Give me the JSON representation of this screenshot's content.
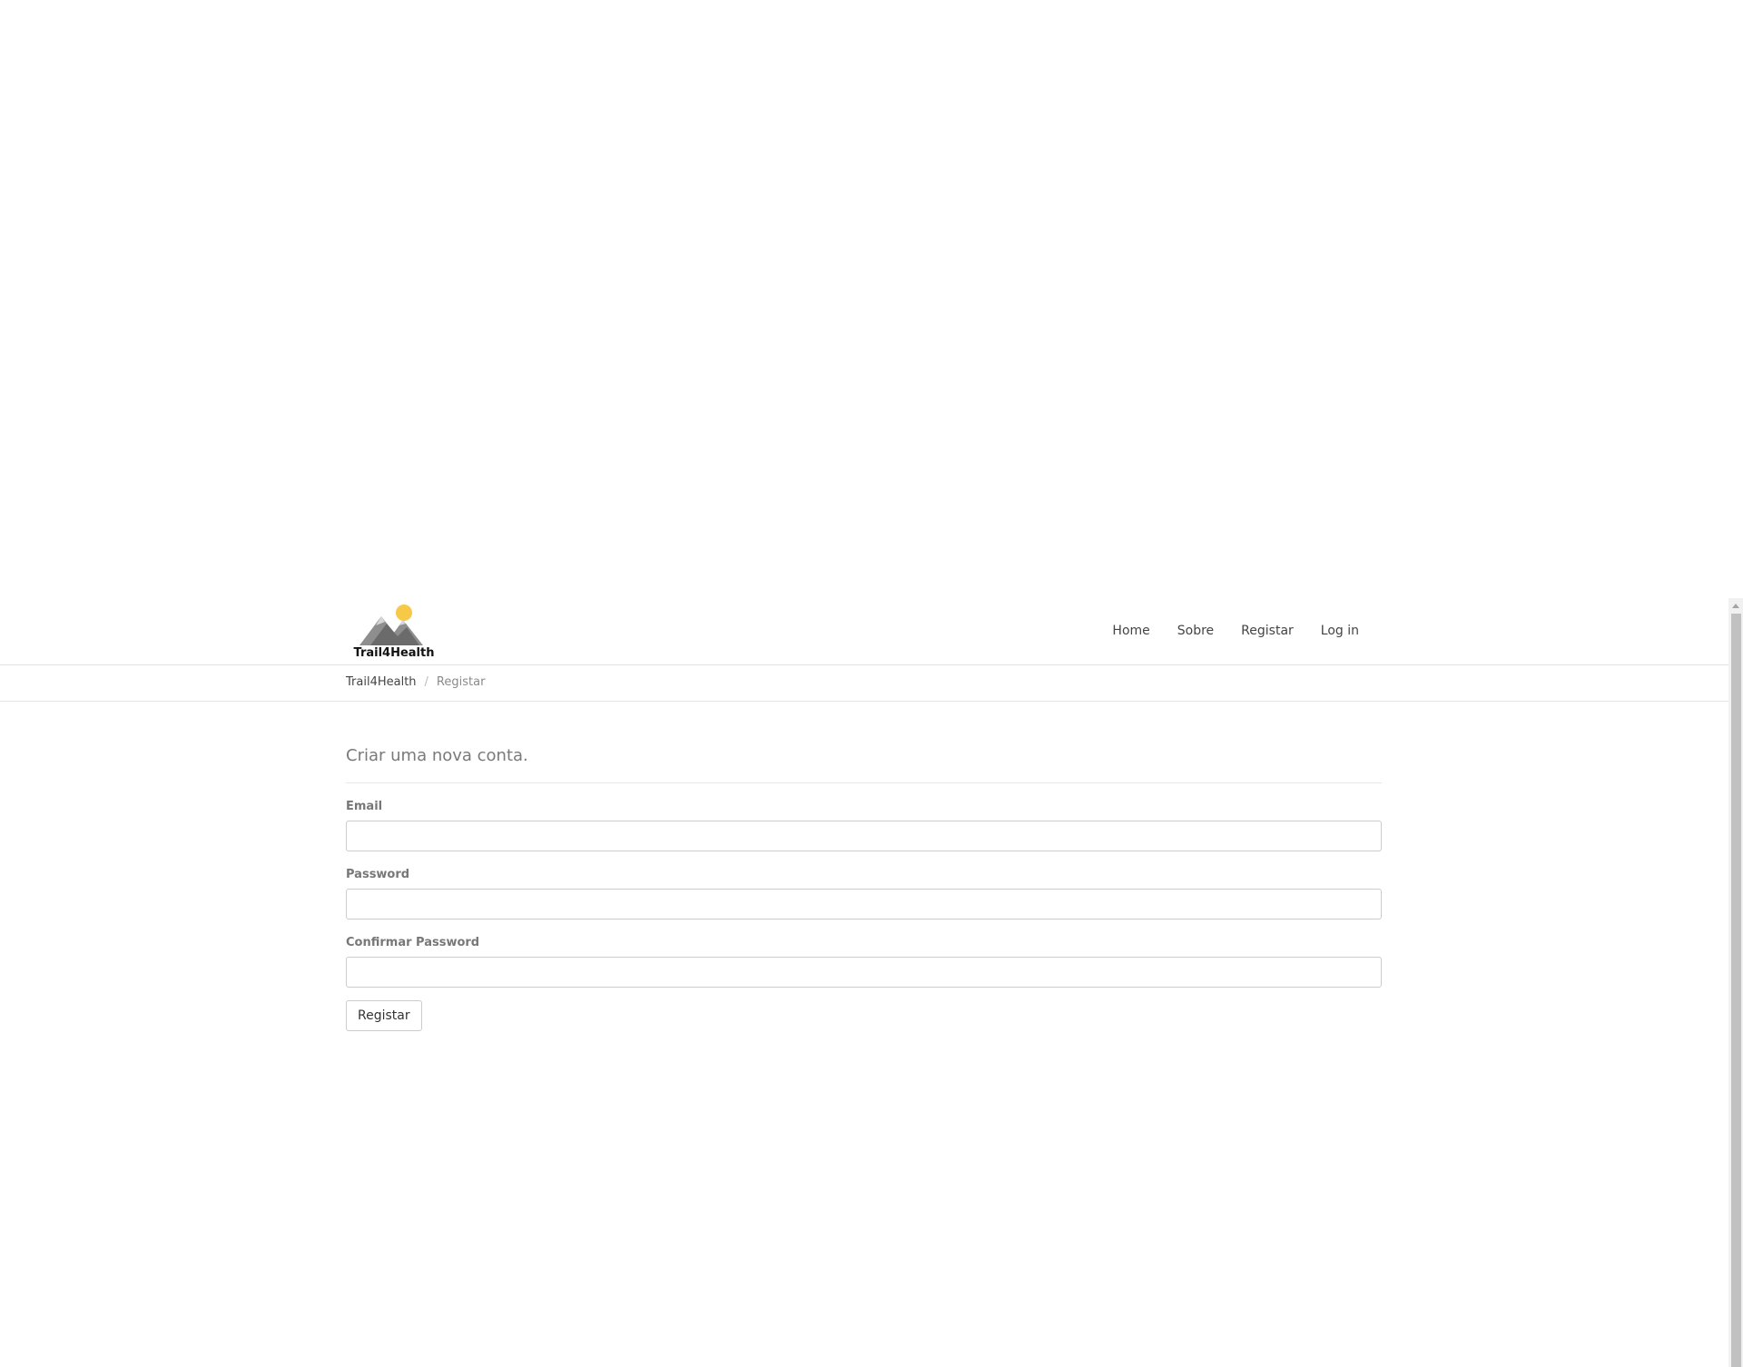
{
  "header": {
    "logo_text": "Trail4Health",
    "nav": [
      {
        "label": "Home"
      },
      {
        "label": "Sobre"
      },
      {
        "label": "Registar"
      },
      {
        "label": "Log in"
      }
    ]
  },
  "breadcrumb": {
    "root": "Trail4Health",
    "separator": "/",
    "current": "Registar"
  },
  "form": {
    "title": "Criar uma nova conta.",
    "fields": [
      {
        "label": "Email",
        "value": "",
        "type": "email"
      },
      {
        "label": "Password",
        "value": "",
        "type": "password"
      },
      {
        "label": "Confirmar Password",
        "value": "",
        "type": "password"
      }
    ],
    "submit_label": "Registar"
  },
  "colors": {
    "sun": "#f7c948",
    "mountain_dark": "#666666",
    "mountain_light": "#a5a5a5",
    "border": "#cccccc"
  }
}
